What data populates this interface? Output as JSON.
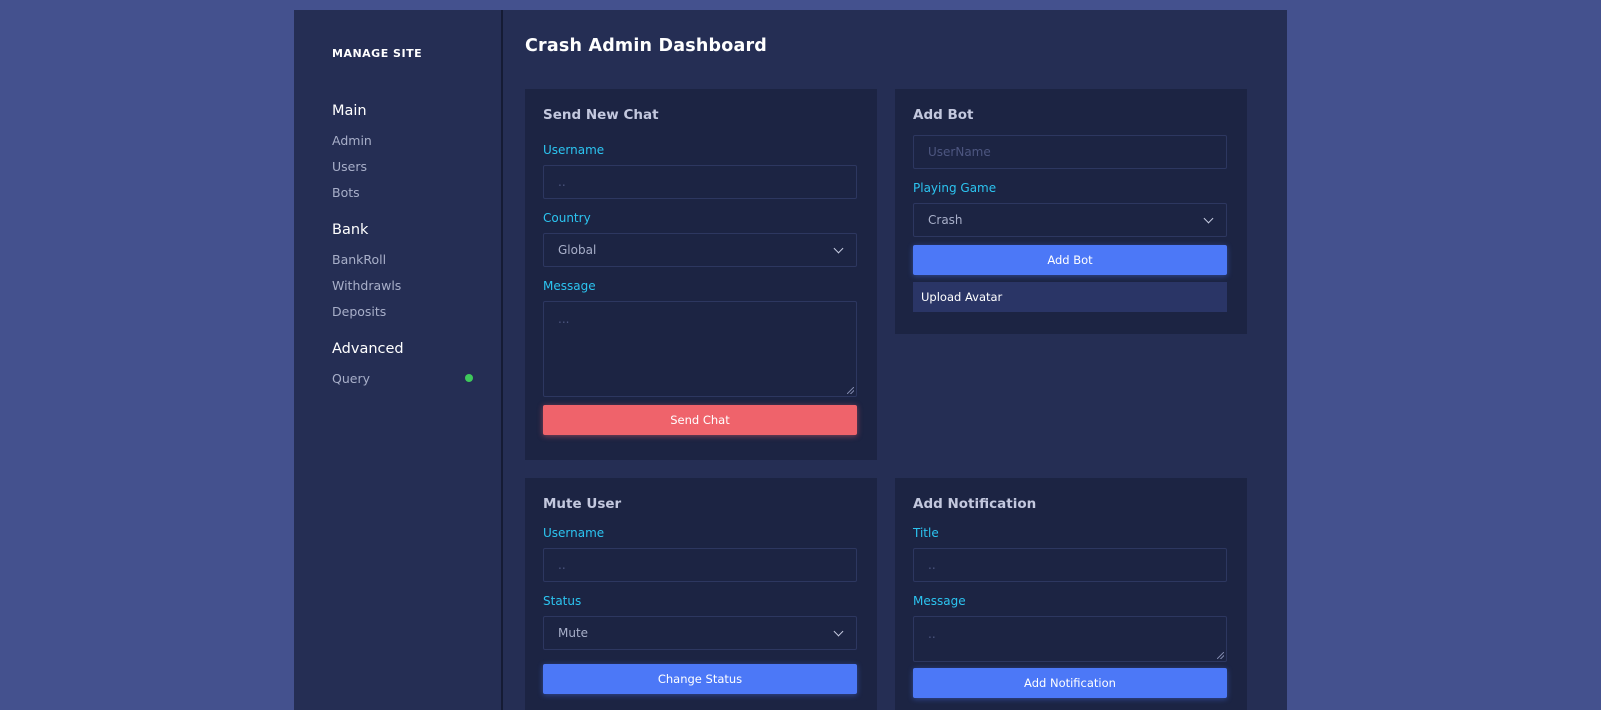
{
  "sidebar": {
    "brand": "MANAGE SITE",
    "groups": [
      {
        "heading": "Main",
        "items": [
          {
            "label": "Admin"
          },
          {
            "label": "Users"
          },
          {
            "label": "Bots"
          }
        ]
      },
      {
        "heading": "Bank",
        "items": [
          {
            "label": "BankRoll"
          },
          {
            "label": "Withdrawls"
          },
          {
            "label": "Deposits"
          }
        ]
      },
      {
        "heading": "Advanced",
        "items": [
          {
            "label": "Query",
            "status_color": "#3ec95b"
          }
        ]
      }
    ]
  },
  "main": {
    "title": "Crash Admin Dashboard",
    "send_chat": {
      "title": "Send New Chat",
      "username_label": "Username",
      "username_placeholder": "..",
      "country_label": "Country",
      "country_value": "Global",
      "message_label": "Message",
      "message_placeholder": "...",
      "button": "Send Chat"
    },
    "add_bot": {
      "title": "Add Bot",
      "username_placeholder": "UserName",
      "game_label": "Playing Game",
      "game_value": "Crash",
      "button": "Add Bot",
      "upload": "Upload Avatar"
    },
    "mute_user": {
      "title": "Mute User",
      "username_label": "Username",
      "username_placeholder": "..",
      "status_label": "Status",
      "status_value": "Mute",
      "button": "Change Status"
    },
    "add_notification": {
      "title": "Add Notification",
      "title_label": "Title",
      "title_placeholder": "..",
      "message_label": "Message",
      "message_placeholder": "..",
      "button": "Add Notification"
    }
  },
  "colors": {
    "background": "#44518e",
    "panel": "#252e54",
    "card": "#1c2443",
    "accent_label": "#2cc4f0",
    "btn_blue": "#4c78f7",
    "btn_red": "#ef636b"
  }
}
